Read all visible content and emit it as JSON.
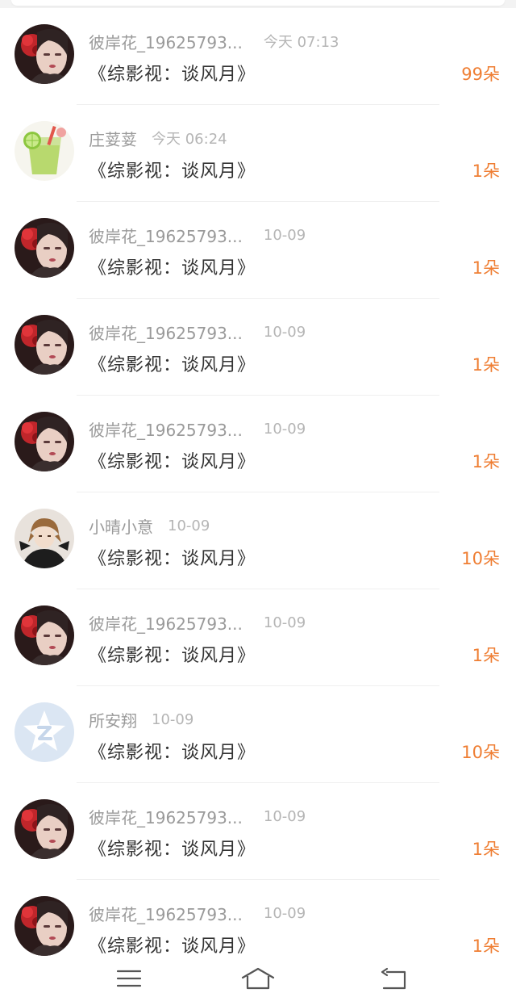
{
  "rows": [
    {
      "name": "彼岸花_19625793...",
      "time": "今天 07:13",
      "title": "《综影视：谈风月》",
      "amount": "99朵",
      "avatar": "girl-red-flower-avatar"
    },
    {
      "name": "庄荽荽",
      "time": "今天 06:24",
      "title": "《综影视：谈风月》",
      "amount": "1朵",
      "avatar": "lime-drink-avatar"
    },
    {
      "name": "彼岸花_19625793...",
      "time": "10-09",
      "title": "《综影视：谈风月》",
      "amount": "1朵",
      "avatar": "girl-red-flower-avatar"
    },
    {
      "name": "彼岸花_19625793...",
      "time": "10-09",
      "title": "《综影视：谈风月》",
      "amount": "1朵",
      "avatar": "girl-red-flower-avatar"
    },
    {
      "name": "彼岸花_19625793...",
      "time": "10-09",
      "title": "《综影视：谈风月》",
      "amount": "1朵",
      "avatar": "girl-red-flower-avatar"
    },
    {
      "name": "小晴小意",
      "time": "10-09",
      "title": "《综影视：谈风月》",
      "amount": "10朵",
      "avatar": "anime-boy-avatar"
    },
    {
      "name": "彼岸花_19625793...",
      "time": "10-09",
      "title": "《综影视：谈风月》",
      "amount": "1朵",
      "avatar": "girl-red-flower-avatar"
    },
    {
      "name": "所安翔",
      "time": "10-09",
      "title": "《综影视：谈风月》",
      "amount": "10朵",
      "avatar": "default-star-avatar"
    },
    {
      "name": "彼岸花_19625793...",
      "time": "10-09",
      "title": "《综影视：谈风月》",
      "amount": "1朵",
      "avatar": "girl-red-flower-avatar"
    },
    {
      "name": "彼岸花_19625793...",
      "time": "10-09",
      "title": "《综影视：谈风月》",
      "amount": "1朵",
      "avatar": "girl-red-flower-avatar"
    }
  ],
  "colors": {
    "accent": "#ef7e33",
    "name": "#9a9a9a",
    "time": "#b5b5b5",
    "title": "#333333"
  },
  "navbar": {
    "menu_icon": "menu-icon",
    "home_icon": "home-icon",
    "back_icon": "back-icon"
  }
}
